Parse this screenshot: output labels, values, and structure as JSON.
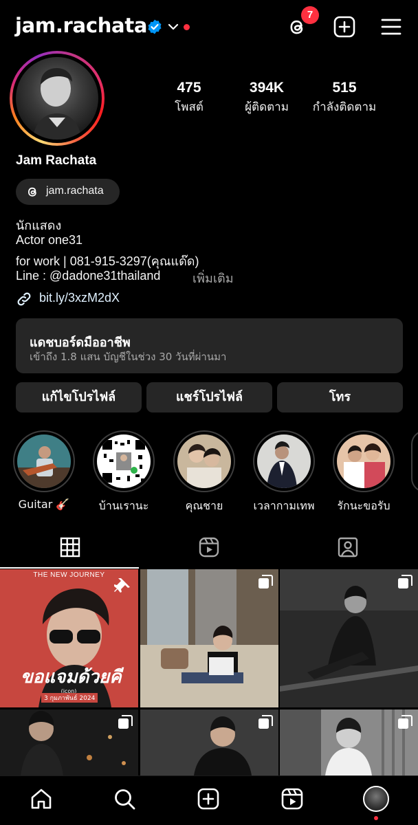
{
  "header": {
    "username": "jam.rachata",
    "notification_count": "7",
    "icons": [
      "verified-badge-icon",
      "chevron-down-icon",
      "threads-icon",
      "add-post-icon",
      "menu-icon"
    ]
  },
  "profile": {
    "stats": [
      {
        "value": "475",
        "label": "โพสต์"
      },
      {
        "value": "394K",
        "label": "ผู้ติดตาม"
      },
      {
        "value": "515",
        "label": "กำลังติดตาม"
      }
    ],
    "full_name": "Jam Rachata",
    "threads_handle": "jam.rachata",
    "bio_lines": [
      "นักแสดง",
      "Actor one31",
      "for work | 081-915-3297(คุณแด๊ด)",
      "Line : @dadone31thailand"
    ],
    "more_label": "เพิ่มเติม",
    "link": "bit.ly/3xzM2dX"
  },
  "dashboard": {
    "title": "แดชบอร์ดมืออาชีพ",
    "subtitle": "เข้าถึง 1.8 แสน บัญชีในช่วง 30 วันที่ผ่านมา"
  },
  "buttons": {
    "edit_profile": "แก้ไขโปรไฟล์",
    "share_profile": "แชร์โปรไฟล์",
    "call": "โทร"
  },
  "highlights": [
    {
      "name": "Guitar 🎸"
    },
    {
      "name": "บ้านเรานะ"
    },
    {
      "name": "คุณชาย"
    },
    {
      "name": "เวลากามเทพ"
    },
    {
      "name": "รักนะขอรับ"
    }
  ],
  "posts": {
    "first_post_title": "THE NEW JOURNEY",
    "first_post_script": "ขอแจมด้วยคี",
    "first_post_date": "3 กุมภาพันธ์ 2024",
    "highlight_poster_text": "รักนะขอรับ"
  },
  "colors": {
    "background": "#000000",
    "surface": "#262626",
    "accent_red": "#ff3040",
    "verified_blue": "#0095f6"
  }
}
